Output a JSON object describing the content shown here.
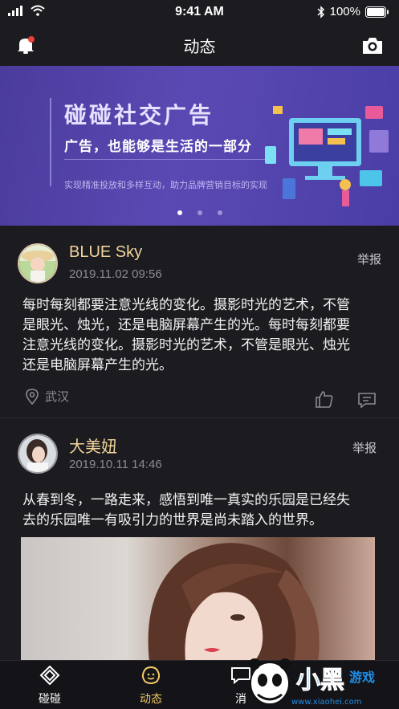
{
  "status": {
    "time": "9:41 AM",
    "battery": "100%"
  },
  "header": {
    "title": "动态"
  },
  "banner": {
    "title": "碰碰社交广告",
    "subtitle": "广告，也能够是生活的一部分",
    "caption": "实现精准投放和多样互动，助力品牌营销目标的实现",
    "page_count": 3,
    "active_page": 0
  },
  "posts": [
    {
      "username": "BLUE Sky",
      "time": "2019.11.02   09:56",
      "report": "举报",
      "text_lines": [
        "每时每刻都要注意光线的变化。摄影时光的艺术，不管",
        "是眼光、烛光，还是电脑屏幕产生的光。每时每刻都要",
        "注意光线的变化。摄影时光的艺术，不管是眼光、烛光",
        "还是电脑屏幕产生的光。"
      ],
      "location": "武汉"
    },
    {
      "username": "大美妞",
      "time": "2019.10.11   14:46",
      "report": "举报",
      "text_lines": [
        "从春到冬，一路走来，感悟到唯一真实的乐园是已经失",
        "去的乐园唯一有吸引力的世界是尚未踏入的世界。"
      ]
    }
  ],
  "tabs": [
    {
      "label": "碰碰",
      "icon": "pengpeng-icon"
    },
    {
      "label": "动态",
      "icon": "moments-icon",
      "active": true
    },
    {
      "label": "消",
      "icon": "message-icon"
    }
  ],
  "watermark": {
    "text": "小黑游戏",
    "url": "www.xiaohei.com"
  },
  "colors": {
    "background": "#1c1b20",
    "accent": "#f0c866",
    "username": "#f0d49a",
    "banner": "#5b49b3"
  }
}
